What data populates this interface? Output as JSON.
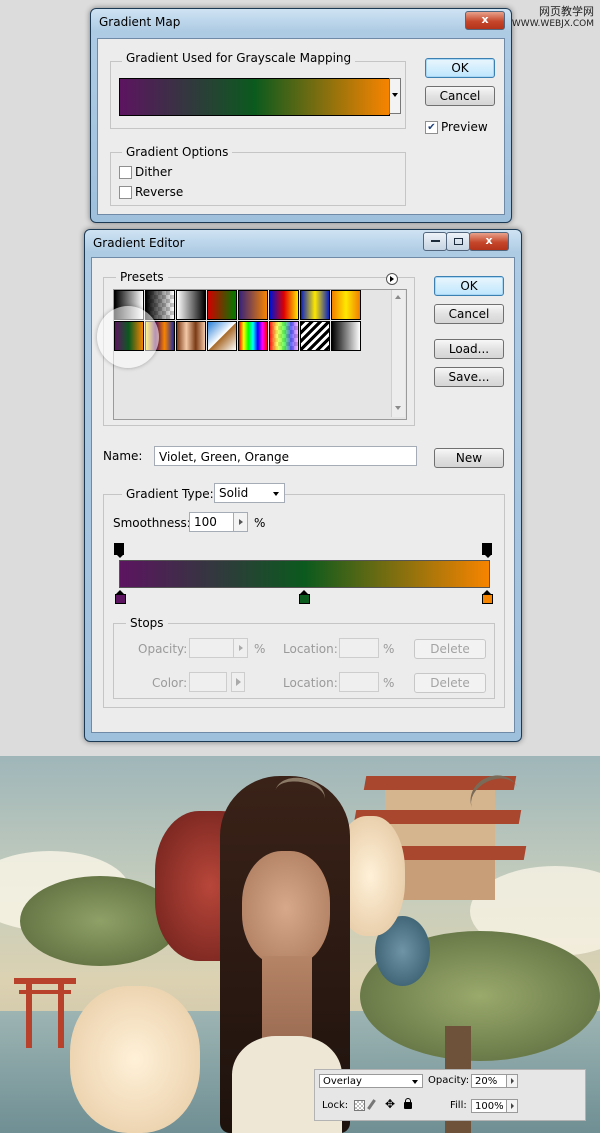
{
  "watermark": {
    "line1": "网页教学网",
    "line2": "WWW.WEBJX.COM"
  },
  "gradient_map": {
    "title": "Gradient Map",
    "gradient_group_label": "Gradient Used for Grayscale Mapping",
    "options_group_label": "Gradient Options",
    "dither_label": "Dither",
    "dither_checked": false,
    "reverse_label": "Reverse",
    "reverse_checked": false,
    "ok_label": "OK",
    "cancel_label": "Cancel",
    "preview_label": "Preview",
    "preview_checked": true,
    "close_glyph": "x"
  },
  "gradient_editor": {
    "title": "Gradient Editor",
    "presets_label": "Presets",
    "ok_label": "OK",
    "cancel_label": "Cancel",
    "load_label": "Load...",
    "save_label": "Save...",
    "name_label": "Name:",
    "name_value": "Violet, Green, Orange",
    "new_label": "New",
    "gradient_type_label": "Gradient Type:",
    "gradient_type_value": "Solid",
    "smoothness_label": "Smoothness:",
    "smoothness_value": "100",
    "smoothness_unit": "%",
    "stops_label": "Stops",
    "opacity_label": "Opacity:",
    "opacity_unit": "%",
    "color_label": "Color:",
    "location_label": "Location:",
    "location_unit": "%",
    "delete_label": "Delete",
    "colors": {
      "violet": "#5c1460",
      "green": "#0b5a1e",
      "orange": "#f78400"
    }
  },
  "layers_panel": {
    "blend_mode": "Overlay",
    "opacity_label": "Opacity:",
    "opacity_value": "20%",
    "lock_label": "Lock:",
    "fill_label": "Fill:",
    "fill_value": "100%"
  }
}
